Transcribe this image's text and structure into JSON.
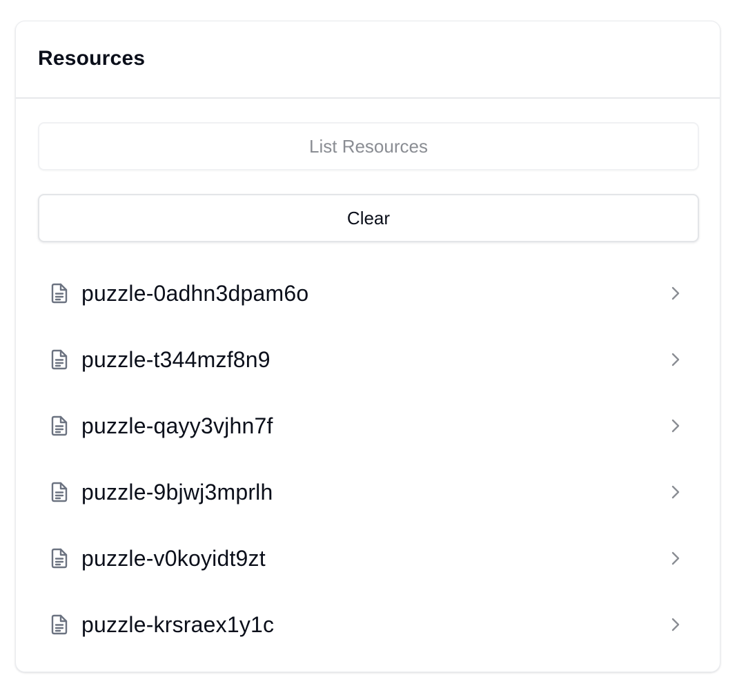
{
  "panel": {
    "title": "Resources",
    "list_button_label": "List Resources",
    "clear_button_label": "Clear"
  },
  "resources": [
    {
      "name": "puzzle-0adhn3dpam6o",
      "icon": "document-icon"
    },
    {
      "name": "puzzle-t344mzf8n9",
      "icon": "document-icon"
    },
    {
      "name": "puzzle-qayy3vjhn7f",
      "icon": "document-icon"
    },
    {
      "name": "puzzle-9bjwj3mprlh",
      "icon": "document-icon"
    },
    {
      "name": "puzzle-v0koyidt9zt",
      "icon": "document-icon"
    },
    {
      "name": "puzzle-krsraex1y1c",
      "icon": "document-icon"
    }
  ],
  "colors": {
    "text": "#0b0f1a",
    "muted_text": "#8a8d93",
    "icon": "#6b7280",
    "border": "#e6e8eb"
  }
}
